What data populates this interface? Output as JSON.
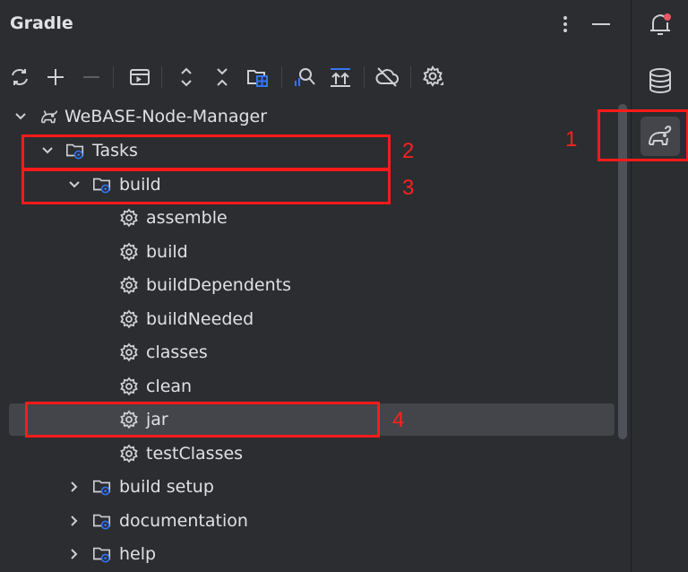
{
  "header": {
    "title": "Gradle"
  },
  "toolbar": {
    "icons": [
      "refresh-icon",
      "add-icon",
      "remove-icon",
      "run-task-icon",
      "expand-all-icon",
      "collapse-all-icon",
      "group-modules-icon",
      "analyze-dependencies-icon",
      "download-sources-icon",
      "offline-mode-icon",
      "settings-icon"
    ]
  },
  "tree": {
    "root": "WeBASE-Node-Manager",
    "tasks": "Tasks",
    "build_group": "build",
    "build_tasks": [
      "assemble",
      "build",
      "buildDependents",
      "buildNeeded",
      "classes",
      "clean",
      "jar",
      "testClasses"
    ],
    "other_groups": [
      "build setup",
      "documentation",
      "help"
    ]
  },
  "annotations": [
    "1",
    "2",
    "3",
    "4"
  ],
  "colors": {
    "accent_red": "#ff1a1a",
    "panel_bg": "#2b2d30",
    "selection": "#43454a",
    "icon_blue": "#3574f0"
  }
}
